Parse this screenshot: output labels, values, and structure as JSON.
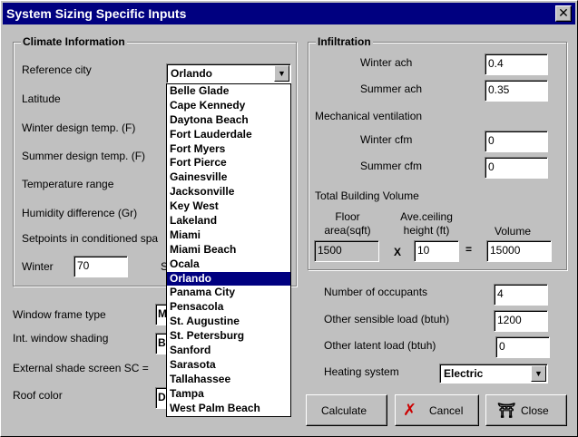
{
  "window": {
    "title": "System Sizing Specific Inputs",
    "close_glyph": "✕"
  },
  "climate": {
    "title": "Climate Information",
    "reference_city_label": "Reference city",
    "reference_city_value": "Orlando",
    "latitude_label": "Latitude",
    "winter_design_label": "Winter design temp. (F)",
    "summer_design_label": "Summer design temp. (F)",
    "temperature_range_label": "Temperature range",
    "humidity_diff_label": "Humidity difference (Gr)",
    "setpoints_label": "Setpoints in conditioned spa",
    "winter_label": "Winter",
    "winter_value": "70",
    "hidden_letter": "S"
  },
  "city_options": [
    "Belle Glade",
    "Cape Kennedy",
    "Daytona Beach",
    "Fort Lauderdale",
    "Fort Myers",
    "Fort Pierce",
    "Gainesville",
    "Jacksonville",
    "Key West",
    "Lakeland",
    "Miami",
    "Miami Beach",
    "Ocala",
    "Orlando",
    "Panama City",
    "Pensacola",
    "St. Augustine",
    "St. Petersburg",
    "Sanford",
    "Sarasota",
    "Tallahassee",
    "Tampa",
    "West Palm Beach"
  ],
  "selected_city_index": 13,
  "lower_left": {
    "window_frame_label": "Window frame type",
    "window_frame_value": "M",
    "shading_label": "Int. window shading",
    "shading_value": "B",
    "external_shade_label": "External shade screen  SC =",
    "roof_color_label": "Roof color",
    "roof_color_value": "D"
  },
  "infiltration": {
    "title": "Infiltration",
    "winter_ach_label": "Winter ach",
    "winter_ach_value": "0.4",
    "summer_ach_label": "Summer ach",
    "summer_ach_value": "0.35",
    "mech_vent_label": "Mechanical ventilation",
    "winter_cfm_label": "Winter cfm",
    "winter_cfm_value": "0",
    "summer_cfm_label": "Summer cfm",
    "summer_cfm_value": "0",
    "volume_title": "Total Building Volume",
    "floor_area_label_1": "Floor",
    "floor_area_label_2": "area(sqft)",
    "ceiling_label_1": "Ave.ceiling",
    "ceiling_label_2": "height (ft)",
    "volume_label": "Volume",
    "floor_area_value": "1500",
    "times_sign": "X",
    "ceiling_value": "10",
    "equals_sign": "=",
    "volume_value": "15000"
  },
  "loads": {
    "occupants_label": "Number of occupants",
    "occupants_value": "4",
    "sensible_label": "Other sensible load (btuh)",
    "sensible_value": "1200",
    "latent_label": "Other latent load (btuh)",
    "latent_value": "0",
    "heating_label": "Heating system",
    "heating_value": "Electric"
  },
  "buttons": {
    "calculate": "Calculate",
    "cancel": "Cancel",
    "close": "Close"
  },
  "colors": {
    "titlebar": "#000080",
    "face": "#c0c0c0",
    "cancel_icon": "#cc0000"
  }
}
